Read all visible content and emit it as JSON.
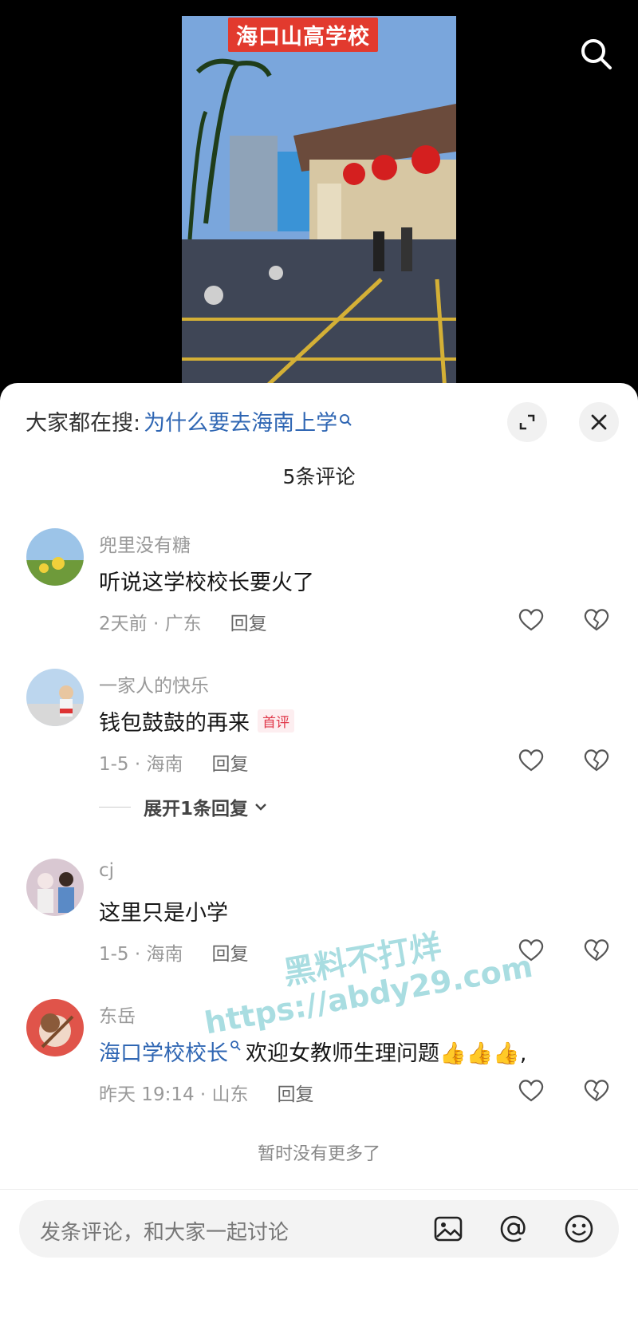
{
  "video": {
    "title": "海口山高学校"
  },
  "search_hint": {
    "prefix": "大家都在搜:",
    "query": "为什么要去海南上学"
  },
  "comment_count": "5条评论",
  "comments": [
    {
      "user": "兜里没有糖",
      "text": "听说这学校校长要火了",
      "time": "2天前 · 广东",
      "reply": "回复"
    },
    {
      "user": "一家人的快乐",
      "text": "钱包鼓鼓的再来",
      "badge": "首评",
      "time": "1-5 · 海南",
      "reply": "回复",
      "expand": "展开1条回复"
    },
    {
      "user": "cj",
      "text": "这里只是小学",
      "time": "1-5 · 海南",
      "reply": "回复"
    },
    {
      "user": "东岳",
      "mention": "海口学校校长",
      "text": "欢迎女教师生理问题👍👍👍,",
      "time": "昨天 19:14 · 山东",
      "reply": "回复"
    }
  ],
  "no_more": "暂时没有更多了",
  "input": {
    "placeholder": "发条评论，和大家一起讨论"
  },
  "watermark": {
    "line1": "黑料不打烊",
    "line2": "https://abdy29.com"
  }
}
